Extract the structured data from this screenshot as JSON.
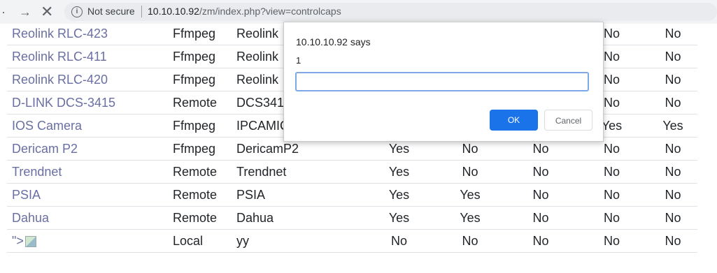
{
  "browser": {
    "back_icon": "arrow-left-icon",
    "forward_icon": "arrow-right-icon",
    "stop_icon": "close-icon",
    "security_label": "Not secure",
    "url_host": "10.10.10.92",
    "url_path": "/zm/index.php?view=controlcaps"
  },
  "table": {
    "rows": [
      {
        "name": "Reolink RLC-423",
        "type": "Ffmpeg",
        "protocol": "Reolink",
        "c1": "",
        "c2": "",
        "c3": "",
        "c4": "No",
        "c5": "No"
      },
      {
        "name": "Reolink RLC-411",
        "type": "Ffmpeg",
        "protocol": "Reolink",
        "c1": "",
        "c2": "",
        "c3": "",
        "c4": "No",
        "c5": "No"
      },
      {
        "name": "Reolink RLC-420",
        "type": "Ffmpeg",
        "protocol": "Reolink",
        "c1": "",
        "c2": "",
        "c3": "",
        "c4": "No",
        "c5": "No"
      },
      {
        "name": "D-LINK DCS-3415",
        "type": "Remote",
        "protocol": "DCS341",
        "c1": "",
        "c2": "",
        "c3": "",
        "c4": "No",
        "c5": "No"
      },
      {
        "name": "IOS Camera",
        "type": "Ffmpeg",
        "protocol": "IPCAMIC",
        "c1": "",
        "c2": "",
        "c3": "",
        "c4": "Yes",
        "c5": "Yes"
      },
      {
        "name": "Dericam P2",
        "type": "Ffmpeg",
        "protocol": "DericamP2",
        "c1": "Yes",
        "c2": "No",
        "c3": "No",
        "c4": "No",
        "c5": "No"
      },
      {
        "name": "Trendnet",
        "type": "Remote",
        "protocol": "Trendnet",
        "c1": "Yes",
        "c2": "No",
        "c3": "No",
        "c4": "No",
        "c5": "No"
      },
      {
        "name": "PSIA",
        "type": "Remote",
        "protocol": "PSIA",
        "c1": "Yes",
        "c2": "Yes",
        "c3": "No",
        "c4": "No",
        "c5": "No"
      },
      {
        "name": "Dahua",
        "type": "Remote",
        "protocol": "Dahua",
        "c1": "Yes",
        "c2": "Yes",
        "c3": "No",
        "c4": "No",
        "c5": "No"
      },
      {
        "name": "\">",
        "type": "Local",
        "protocol": "yy",
        "c1": "No",
        "c2": "No",
        "c3": "No",
        "c4": "No",
        "c5": "No"
      }
    ]
  },
  "dialog": {
    "title": "10.10.10.92 says",
    "message": "1",
    "input_value": "",
    "ok_label": "OK",
    "cancel_label": "Cancel"
  },
  "colors": {
    "link": "#6a6fa3",
    "primary_button": "#1a73e8"
  }
}
